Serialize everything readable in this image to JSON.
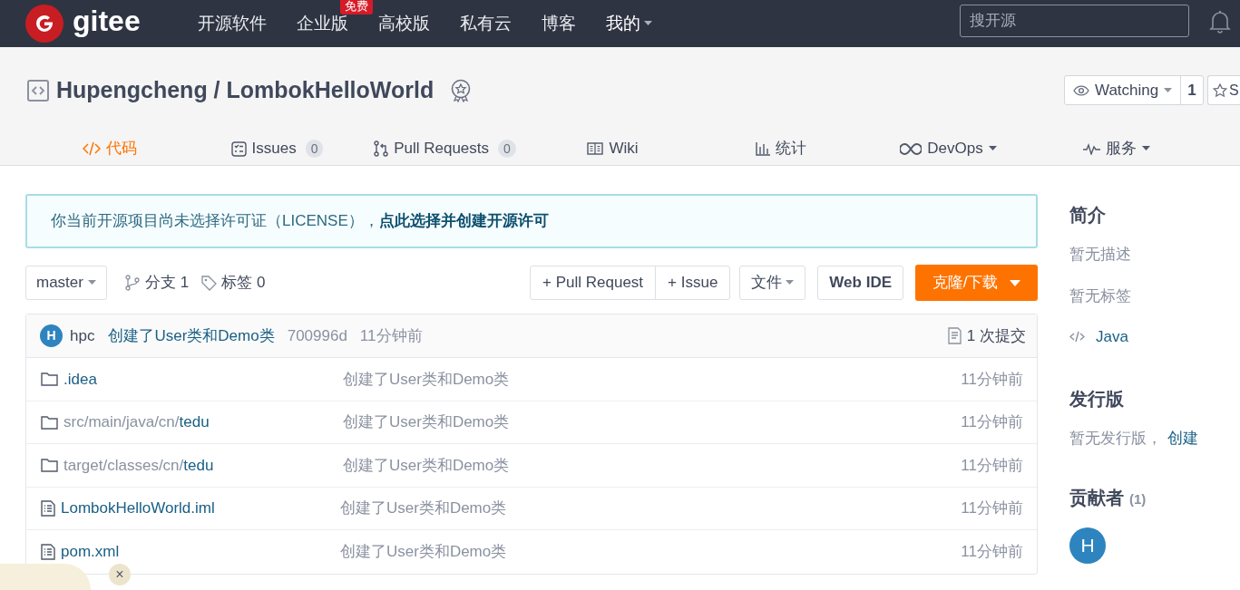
{
  "navbar": {
    "logo_text": "gitee",
    "items": [
      {
        "label": "开源软件",
        "dropdown": false
      },
      {
        "label": "企业版",
        "badge": "免费",
        "dropdown": false
      },
      {
        "label": "高校版",
        "dropdown": false
      },
      {
        "label": "私有云",
        "dropdown": false
      },
      {
        "label": "博客",
        "dropdown": false
      },
      {
        "label": "我的",
        "dropdown": true
      }
    ],
    "search": {
      "placeholder": "搜开源"
    }
  },
  "repo": {
    "owner": "Hupengcheng",
    "separator": "/",
    "name": "LombokHelloWorld",
    "watch": {
      "label": "Watching",
      "count": "1"
    },
    "star": {
      "label": "S"
    }
  },
  "tabs": [
    {
      "kind": "code",
      "label": "代码",
      "dropdown": false,
      "selected": true
    },
    {
      "kind": "issues",
      "label": "Issues",
      "count": "0",
      "dropdown": false,
      "selected": false
    },
    {
      "kind": "pulls",
      "label": "Pull Requests",
      "count": "0",
      "dropdown": false,
      "selected": false
    },
    {
      "kind": "wiki",
      "label": "Wiki",
      "dropdown": false,
      "selected": false
    },
    {
      "kind": "stats",
      "label": "统计",
      "dropdown": false,
      "selected": false
    },
    {
      "kind": "devops",
      "label": "DevOps",
      "dropdown": true,
      "selected": false
    },
    {
      "kind": "service",
      "label": "服务",
      "dropdown": true,
      "selected": false
    }
  ],
  "license_notice": {
    "text": "你当前开源项目尚未选择许可证（LICENSE），",
    "link": "点此选择并创建开源许可"
  },
  "toolbar": {
    "branch": "master",
    "branches": "分支 1",
    "tags": "标签 0",
    "buttons": [
      "+ Pull Request",
      "+ Issue"
    ],
    "file": "文件",
    "webide": "Web IDE",
    "clone": "克隆/下载"
  },
  "commit": {
    "avatar": "H",
    "author": "hpc",
    "message": "创建了User类和Demo类",
    "hash": "700996d",
    "time": "11分钟前",
    "commits": "1 次提交"
  },
  "files": [
    {
      "kind": "folder",
      "name": ".idea",
      "message": "创建了User类和Demo类",
      "time": "11分钟前"
    },
    {
      "kind": "folder",
      "prefix": "src/main/java/cn/",
      "name": "tedu",
      "message": "创建了User类和Demo类",
      "time": "11分钟前"
    },
    {
      "kind": "folder",
      "prefix": "target/classes/cn/",
      "name": "tedu",
      "message": "创建了User类和Demo类",
      "time": "11分钟前"
    },
    {
      "kind": "file",
      "name": "LombokHelloWorld.iml",
      "message": "创建了User类和Demo类",
      "time": "11分钟前"
    },
    {
      "kind": "file",
      "name": "pom.xml",
      "message": "创建了User类和Demo类",
      "time": "11分钟前"
    }
  ],
  "sidebar": {
    "intro_title": "简介",
    "no_description": "暂无描述",
    "no_tags": "暂无标签",
    "language": "Java",
    "releases_title": "发行版",
    "no_releases": "暂无发行版，",
    "create_link": "创建",
    "contributors_title": "贡献者",
    "contributors_count": "(1)",
    "contributors": [
      {
        "initial": "H"
      }
    ]
  },
  "floating_widget": {
    "close": "×"
  }
}
